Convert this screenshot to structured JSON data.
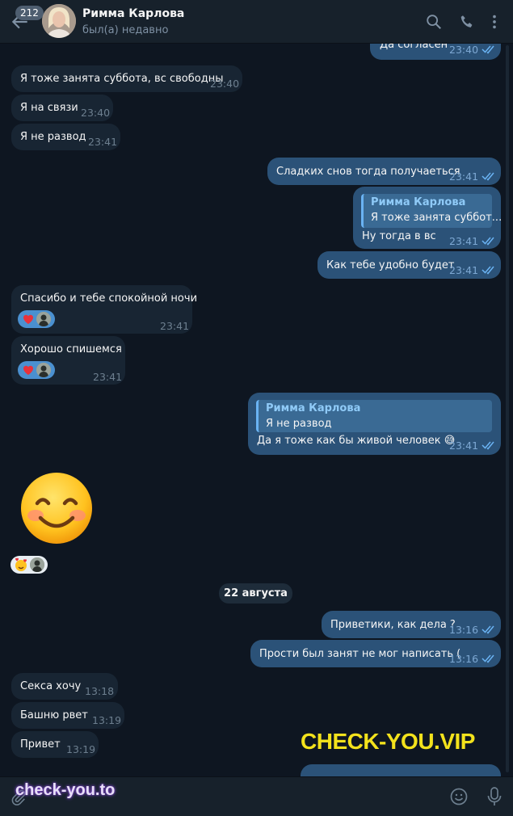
{
  "header": {
    "unread_count": "212",
    "chat_name": "Римма Карлова",
    "status": "был(а) недавно",
    "icons": [
      "back-arrow-icon",
      "search-icon",
      "phone-icon",
      "more-vert-icon"
    ]
  },
  "messages": [
    {
      "dir": "out",
      "text": "Да согласен",
      "time": "23:40",
      "read": true
    },
    {
      "dir": "in",
      "text": "Я тоже занята суббота, вс свободны",
      "time": "23:40"
    },
    {
      "dir": "in",
      "text": "Я на связи",
      "time": "23:40"
    },
    {
      "dir": "in",
      "text": "Я не развод",
      "time": "23:41"
    },
    {
      "dir": "out",
      "text": "Сладких снов тогда получаеться",
      "time": "23:41",
      "read": true
    },
    {
      "dir": "out",
      "reply_name": "Римма Карлова",
      "reply_text": "Я тоже занята суббот...",
      "text": "Ну тогда в вс",
      "time": "23:41",
      "read": true
    },
    {
      "dir": "out",
      "text": "Как тебе удобно будет",
      "time": "23:41",
      "read": true
    },
    {
      "dir": "in",
      "text": "Спасибо и тебе спокойной ночи",
      "time": "23:41",
      "reaction": "heart"
    },
    {
      "dir": "in",
      "text": "Хорошо спишемся",
      "time": "23:41",
      "reaction": "heart"
    },
    {
      "dir": "out",
      "reply_name": "Римма Карлова",
      "reply_text": "Я не развод",
      "text": "Да я тоже как бы живой человек 😅",
      "time": "23:41",
      "read": true
    },
    {
      "dir": "in",
      "sticker": "smiling-face-emoji",
      "reaction": "hearts-face"
    },
    {
      "dir": "out",
      "text": "Приветики, как дела ?",
      "time": "13:16",
      "read": true
    },
    {
      "dir": "out",
      "text": "Прости был занят не мог написать (",
      "time": "13:16",
      "read": true
    },
    {
      "dir": "in",
      "text": "Секса хочу",
      "time": "13:18"
    },
    {
      "dir": "in",
      "text": "Башню рвет",
      "time": "13:19"
    },
    {
      "dir": "in",
      "text": "Привет",
      "time": "13:19"
    }
  ],
  "date_separator": "22 августа",
  "watermark_top": "CHECK-YOU.VIP",
  "watermark_bottom": "check-you.to",
  "input": {
    "placeholder": "",
    "value": ""
  },
  "colors": {
    "background": "#0e1621",
    "header": "#17212b",
    "bubble_in": "#182533",
    "bubble_out": "#2b5278",
    "accent": "#6ab3f3",
    "reaction": "#4a90d0",
    "watermark": "#f3e21c"
  }
}
